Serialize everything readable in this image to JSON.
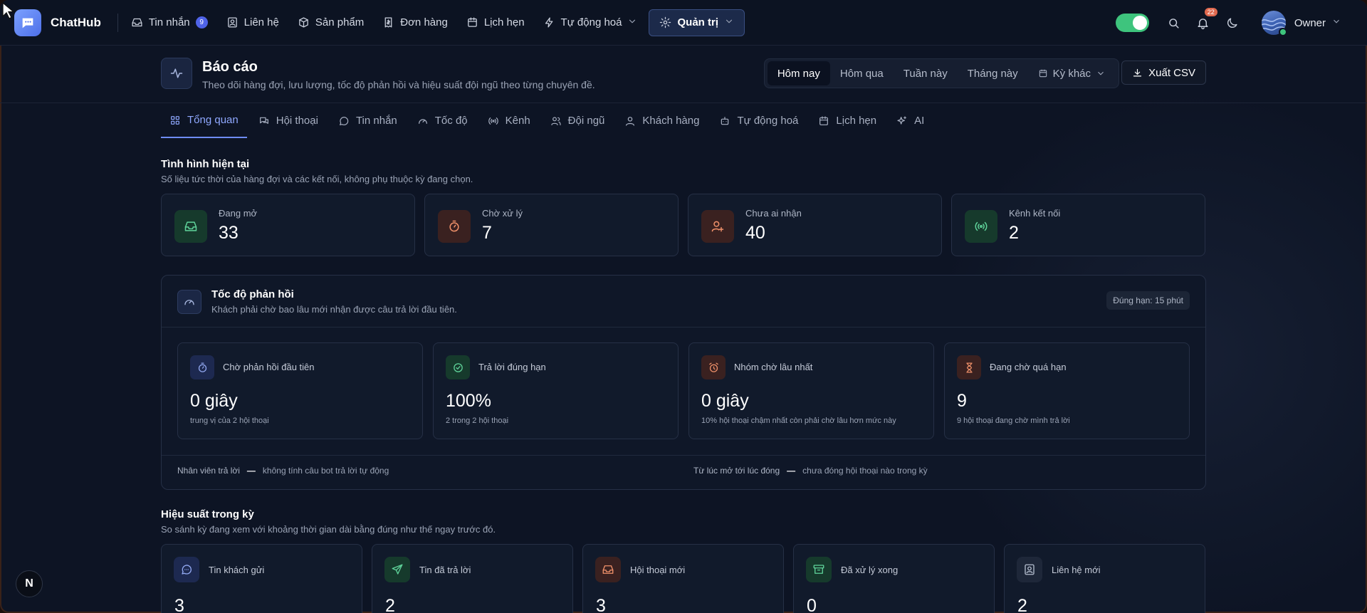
{
  "app": {
    "name": "ChatHub"
  },
  "nav": {
    "items": [
      {
        "label": "Tin nhắn",
        "badge": "9",
        "icon": "inbox-icon"
      },
      {
        "label": "Liên hệ",
        "icon": "contact-card-icon"
      },
      {
        "label": "Sản phẩm",
        "icon": "box-icon"
      },
      {
        "label": "Đơn hàng",
        "icon": "receipt-icon"
      },
      {
        "label": "Lịch hẹn",
        "icon": "calendar-icon"
      },
      {
        "label": "Tự động hoá",
        "icon": "bolt-icon"
      },
      {
        "label": "Quản trị",
        "icon": "gear-icon"
      }
    ],
    "notifications": "22",
    "user": "Owner"
  },
  "header": {
    "title": "Báo cáo",
    "subtitle": "Theo dõi hàng đợi, lưu lượng, tốc độ phản hồi và hiệu suất đội ngũ theo từng chuyên đề.",
    "ranges": [
      "Hôm nay",
      "Hôm qua",
      "Tuần này",
      "Tháng này",
      "Kỳ khác"
    ],
    "selected_range": "Hôm nay",
    "export_label": "Xuất CSV"
  },
  "tabs": [
    "Tổng quan",
    "Hội thoại",
    "Tin nhắn",
    "Tốc độ",
    "Kênh",
    "Đội ngũ",
    "Khách hàng",
    "Tự động hoá",
    "Lịch hẹn",
    "AI"
  ],
  "current": {
    "title": "Tình hình hiện tại",
    "subtitle": "Số liệu tức thời của hàng đợi và các kết nối, không phụ thuộc kỳ đang chọn.",
    "cards": [
      {
        "label": "Đang mở",
        "value": "33"
      },
      {
        "label": "Chờ xử lý",
        "value": "7"
      },
      {
        "label": "Chưa ai nhận",
        "value": "40"
      },
      {
        "label": "Kênh kết nối",
        "value": "2"
      }
    ]
  },
  "speed": {
    "title": "Tốc độ phản hồi",
    "subtitle": "Khách phải chờ bao lâu mới nhận được câu trả lời đầu tiên.",
    "badge": "Đúng hạn: 15 phút",
    "metrics": [
      {
        "label": "Chờ phản hồi đầu tiên",
        "value": "0 giây",
        "note": "trung vị của 2 hội thoại"
      },
      {
        "label": "Trả lời đúng hạn",
        "value": "100%",
        "note": "2 trong 2 hội thoại"
      },
      {
        "label": "Nhóm chờ lâu nhất",
        "value": "0 giây",
        "note": "10% hội thoại chậm nhất còn phải chờ lâu hơn mức này"
      },
      {
        "label": "Đang chờ quá hạn",
        "value": "9",
        "note": "9 hội thoại đang chờ mình trả lời"
      }
    ],
    "footer": [
      {
        "label": "Nhân viên trả lời",
        "value": "—",
        "note": "không tính câu bot trả lời tự động"
      },
      {
        "label": "Từ lúc mở tới lúc đóng",
        "value": "—",
        "note": "chưa đóng hội thoại nào trong kỳ"
      }
    ]
  },
  "performance": {
    "title": "Hiệu suất trong kỳ",
    "subtitle": "So sánh kỳ đang xem với khoảng thời gian dài bằng đúng như thế ngay trước đó.",
    "cards": [
      {
        "label": "Tin khách gửi",
        "value": "3"
      },
      {
        "label": "Tin đã trả lời",
        "value": "2"
      },
      {
        "label": "Hội thoại mới",
        "value": "3"
      },
      {
        "label": "Đã xử lý xong",
        "value": "0"
      },
      {
        "label": "Liên hệ mới",
        "value": "2"
      }
    ]
  },
  "misc": {
    "dev_badge": "N"
  }
}
